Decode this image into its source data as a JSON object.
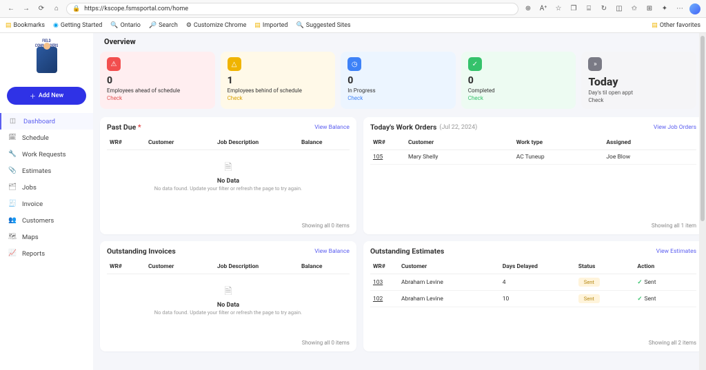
{
  "browser": {
    "url": "https://kscope.fsmsportal.com/home",
    "bookmarks": [
      "Bookmarks",
      "Getting Started",
      "Ontario",
      "Search",
      "Customize Chrome",
      "Imported",
      "Suggested Sites"
    ],
    "other_favorites": "Other favorites"
  },
  "app": {
    "logo_text": "FIELD COMMANDERS",
    "add_btn": "Add New"
  },
  "sidebar": {
    "items": [
      {
        "label": "Dashboard"
      },
      {
        "label": "Schedule"
      },
      {
        "label": "Work Requests"
      },
      {
        "label": "Estimates"
      },
      {
        "label": "Jobs"
      },
      {
        "label": "Invoice"
      },
      {
        "label": "Customers"
      },
      {
        "label": "Maps"
      },
      {
        "label": "Reports"
      }
    ]
  },
  "overview": {
    "title": "Overview",
    "check_label": "Check",
    "cards": [
      {
        "value": "0",
        "label": "Employees ahead of schedule"
      },
      {
        "value": "1",
        "label": "Employees behind of schedule"
      },
      {
        "value": "0",
        "label": "In Progress"
      },
      {
        "value": "0",
        "label": "Completed"
      },
      {
        "value": "Today",
        "label": "Day's til open appt"
      }
    ]
  },
  "pastdue": {
    "title": "Past Due",
    "link": "View Balance",
    "cols": {
      "c1": "WR#",
      "c2": "Customer",
      "c3": "Job Description",
      "c4": "Balance"
    },
    "nodata": {
      "title": "No Data",
      "msg": "No data found. Update your filter or refresh the page to try again."
    },
    "foot": "Showing all 0 items"
  },
  "today_wo": {
    "title": "Today's Work Orders",
    "date": "(Jul 22, 2024)",
    "link": "View Job Orders",
    "cols": {
      "c1": "WR#",
      "c2": "Customer",
      "c3": "Work type",
      "c4": "Assigned"
    },
    "rows": [
      {
        "id": "105",
        "customer": "Mary Shelly",
        "worktype": "AC Tuneup",
        "assigned": "Joe Blow"
      }
    ],
    "foot": "Showing all 1 item"
  },
  "invoices": {
    "title": "Outstanding Invoices",
    "link": "View Balance",
    "cols": {
      "c1": "WR#",
      "c2": "Customer",
      "c3": "Job Description",
      "c4": "Balance"
    },
    "nodata": {
      "title": "No Data",
      "msg": "No data found. Update your filter or refresh the page to try again."
    },
    "foot": "Showing all 0 items"
  },
  "estimates": {
    "title": "Outstanding Estimates",
    "link": "View Estimates",
    "cols": {
      "c1": "WR#",
      "c2": "Customer",
      "c3": "Days Delayed",
      "c4": "Status",
      "c5": "Action"
    },
    "rows": [
      {
        "id": "103",
        "customer": "Abraham Levine",
        "days": "4",
        "status": "Sent",
        "action": "Sent"
      },
      {
        "id": "102",
        "customer": "Abraham Levine",
        "days": "10",
        "status": "Sent",
        "action": "Sent"
      }
    ],
    "foot": "Showing all 2 items"
  }
}
